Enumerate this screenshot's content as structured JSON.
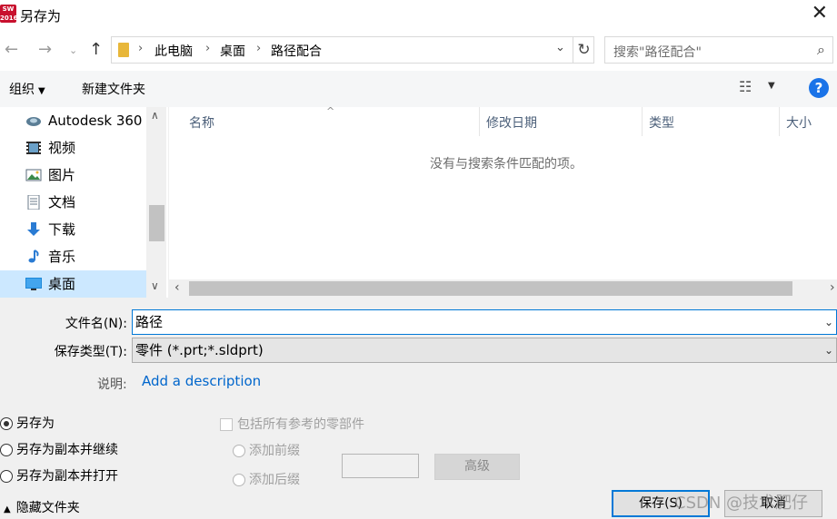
{
  "window": {
    "title": "另存为",
    "app_icon_text": "SW 2016"
  },
  "navigation": {
    "back_icon": "arrow-left-icon",
    "forward_icon": "arrow-right-icon",
    "history_icon": "chevron-down-icon",
    "up_icon": "arrow-up-icon",
    "breadcrumbs": [
      "此电脑",
      "桌面",
      "路径配合"
    ],
    "separator": "›",
    "search_placeholder": "搜索\"路径配合\""
  },
  "toolbar": {
    "organize_label": "组织",
    "new_folder_label": "新建文件夹"
  },
  "sidebar": {
    "items": [
      {
        "label": "Autodesk 360",
        "icon": "autodesk-360-icon"
      },
      {
        "label": "视频",
        "icon": "video-icon"
      },
      {
        "label": "图片",
        "icon": "picture-icon"
      },
      {
        "label": "文档",
        "icon": "document-icon"
      },
      {
        "label": "下载",
        "icon": "download-icon"
      },
      {
        "label": "音乐",
        "icon": "music-icon"
      },
      {
        "label": "桌面",
        "icon": "desktop-icon",
        "selected": true
      }
    ]
  },
  "file_list": {
    "columns": [
      "名称",
      "修改日期",
      "类型",
      "大小"
    ],
    "empty_message": "没有与搜索条件匹配的项。"
  },
  "form": {
    "filename_label": "文件名(N):",
    "filename_value": "路径",
    "filetype_label": "保存类型(T):",
    "filetype_value": "零件 (*.prt;*.sldprt)",
    "description_label": "说明:",
    "description_link": "Add a description"
  },
  "options": {
    "radios": [
      {
        "label": "另存为",
        "checked": true
      },
      {
        "label": "另存为副本并继续",
        "checked": false
      },
      {
        "label": "另存为副本并打开",
        "checked": false
      }
    ],
    "include_refs_label": "包括所有参考的零部件",
    "add_prefix_label": "添加前缀",
    "add_suffix_label": "添加后缀",
    "advanced_label": "高级"
  },
  "footer": {
    "hide_folders_label": "隐藏文件夹",
    "save_label": "保存(S)",
    "cancel_label": "取消",
    "watermark": "CSDN @技术肥仔"
  },
  "colors": {
    "accent": "#0078d7",
    "selection": "#cce8ff",
    "link": "#0066cc",
    "help": "#1a73e8"
  }
}
